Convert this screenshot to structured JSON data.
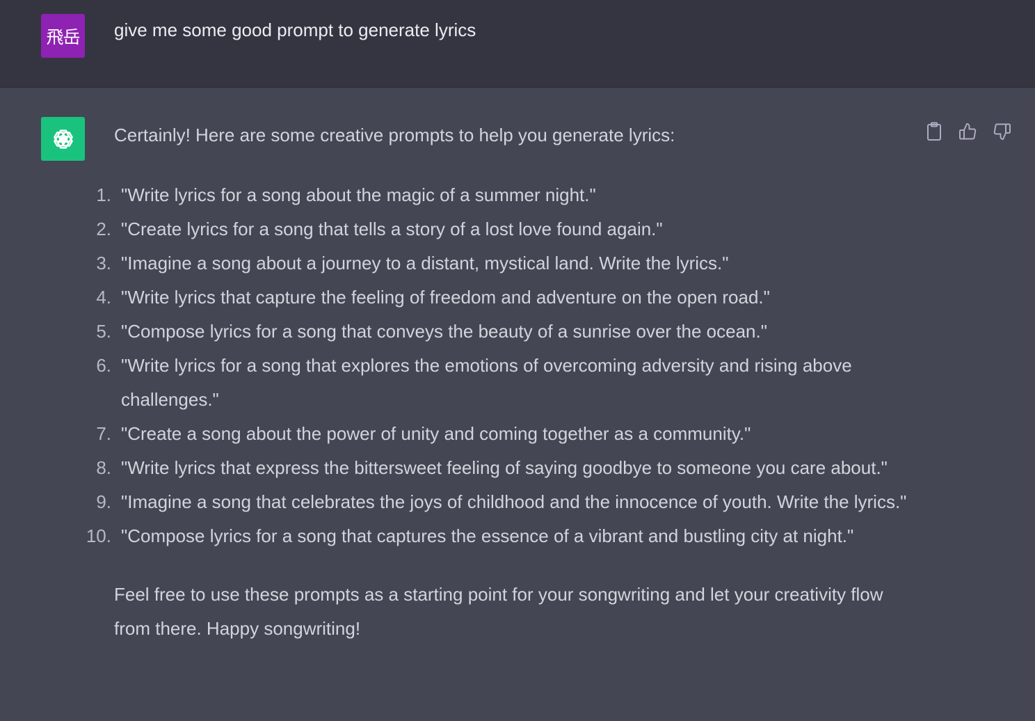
{
  "user": {
    "avatar_text": "飛岳",
    "avatar_color": "#8e22b3",
    "message": "give me some good prompt to generate lyrics"
  },
  "assistant": {
    "avatar_color": "#19c37d",
    "avatar_icon": "openai-logo-icon",
    "intro": "Certainly! Here are some creative prompts to help you generate lyrics:",
    "prompts": [
      {
        "num": "1.",
        "text": "\"Write lyrics for a song about the magic of a summer night.\""
      },
      {
        "num": "2.",
        "text": "\"Create lyrics for a song that tells a story of a lost love found again.\""
      },
      {
        "num": "3.",
        "text": "\"Imagine a song about a journey to a distant, mystical land. Write the lyrics.\""
      },
      {
        "num": "4.",
        "text": "\"Write lyrics that capture the feeling of freedom and adventure on the open road.\""
      },
      {
        "num": "5.",
        "text": "\"Compose lyrics for a song that conveys the beauty of a sunrise over the ocean.\""
      },
      {
        "num": "6.",
        "text": "\"Write lyrics for a song that explores the emotions of overcoming adversity and rising above challenges.\""
      },
      {
        "num": "7.",
        "text": "\"Create a song about the power of unity and coming together as a community.\""
      },
      {
        "num": "8.",
        "text": "\"Write lyrics that express the bittersweet feeling of saying goodbye to someone you care about.\""
      },
      {
        "num": "9.",
        "text": "\"Imagine a song that celebrates the joys of childhood and the innocence of youth. Write the lyrics.\""
      },
      {
        "num": "10.",
        "text": "\"Compose lyrics for a song that captures the essence of a vibrant and bustling city at night.\""
      }
    ],
    "outro": "Feel free to use these prompts as a starting point for your songwriting and let your creativity flow from there. Happy songwriting!",
    "actions": [
      "clipboard-icon",
      "thumbs-up-icon",
      "thumbs-down-icon"
    ]
  },
  "colors": {
    "user_bg": "#343541",
    "assistant_bg": "#444654",
    "text": "#d1d5db"
  }
}
